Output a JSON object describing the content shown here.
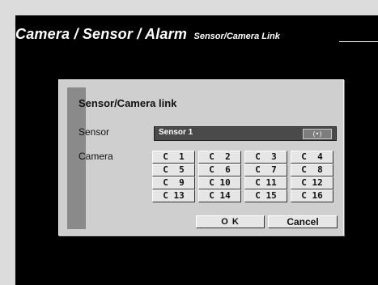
{
  "header": {
    "title": "Camera / Sensor / Alarm",
    "subtitle": "Sensor/Camera Link"
  },
  "dialog": {
    "title": "Sensor/Camera link",
    "sensor_label": "Sensor",
    "sensor_value": "Sensor 1",
    "sensor_icon_glyph": "(•)",
    "camera_label": "Camera",
    "cameras": [
      "C  1",
      "C  2",
      "C  3",
      "C  4",
      "C  5",
      "C  6",
      "C  7",
      "C  8",
      "C  9",
      "C 10",
      "C 11",
      "C 12",
      "C 13",
      "C 14",
      "C 15",
      "C 16"
    ],
    "ok_label": "O K",
    "cancel_label": "Cancel"
  },
  "colors": {
    "screen_bg": "#000000",
    "dialog_bg": "#cfcfcf",
    "stripe": "#8a8a8a",
    "field_bg": "#4a4a4a",
    "button_bg": "#e6e6e6"
  }
}
